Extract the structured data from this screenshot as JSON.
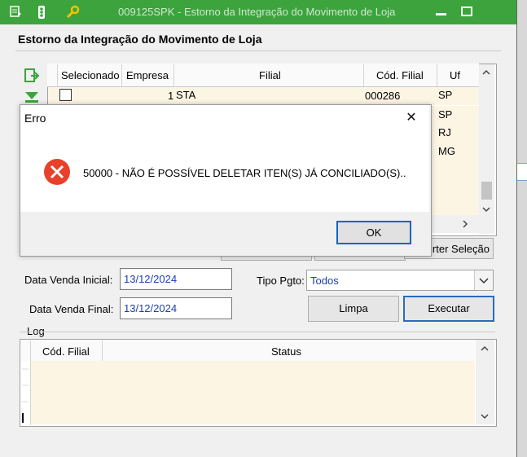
{
  "window": {
    "title": "009125SPK - Estorno da Integração do Movimento de Loja",
    "heading": "Estorno da Integração do Movimento de Loja"
  },
  "grid": {
    "columns": [
      "Selecionado",
      "Empresa",
      "Filial",
      "Cód. Filial",
      "Uf"
    ],
    "rows": [
      {
        "empresa": "1",
        "filial": "STA",
        "cod_filial": "000286",
        "uf": "SP"
      },
      {
        "uf": "SP"
      },
      {
        "uf": "RJ"
      },
      {
        "uf": "MG"
      }
    ],
    "inverter_label": "rter Seleção"
  },
  "filters": {
    "data_inicial_label": "Data Venda Inicial:",
    "data_inicial_value": "13/12/2024",
    "data_final_label": "Data Venda Final:",
    "data_final_value": "13/12/2024",
    "tipo_pgto_label": "Tipo Pgto:",
    "tipo_pgto_value": "Todos",
    "limpa_label": "Limpa",
    "executar_label": "Executar"
  },
  "log": {
    "label": "Log",
    "columns": [
      "Cód. Filial",
      "Status"
    ]
  },
  "dialog": {
    "title": "Erro",
    "message": "50000 - NÃO É POSSÍVEL DELETAR ITEN(S) JÁ CONCILIADO(S)..",
    "ok_label": "OK",
    "close_glyph": "✕",
    "error_icon_color": "#e8402a"
  },
  "colors": {
    "titlebar": "#3da43d",
    "row_bg": "#fdf5e4",
    "input_text": "#1a3eb0"
  }
}
